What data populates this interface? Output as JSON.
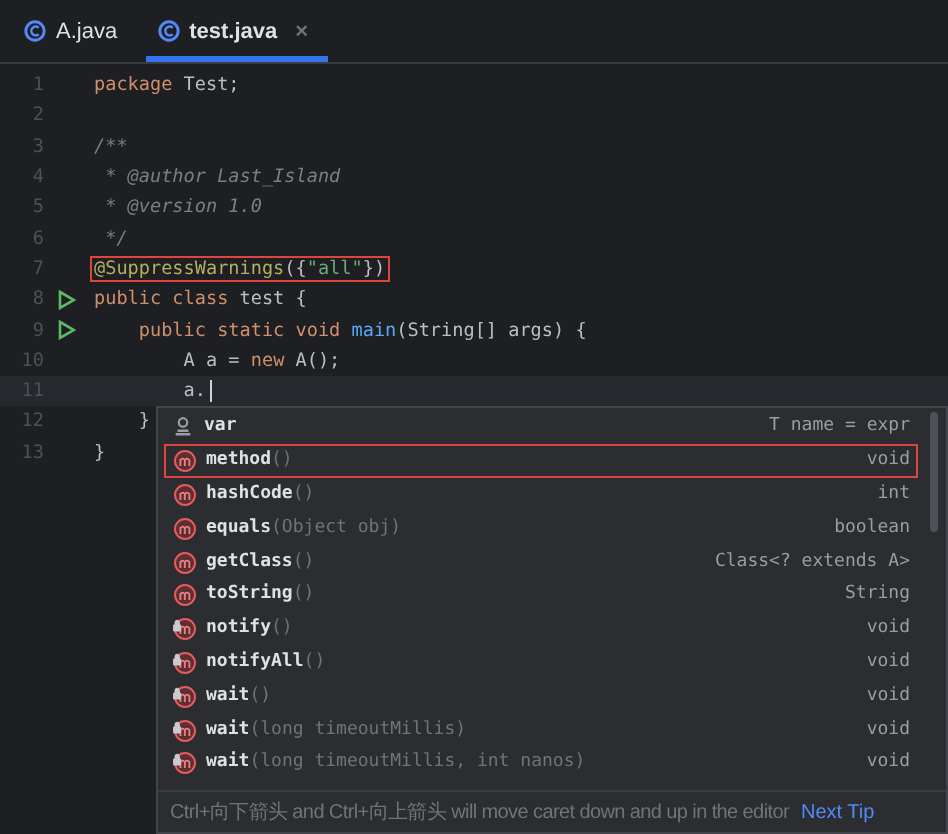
{
  "tabs": [
    {
      "label": "A.java",
      "selected": false
    },
    {
      "label": "test.java",
      "selected": true,
      "close": "×"
    }
  ],
  "code_lines": [
    {
      "number": "1",
      "run": false,
      "current": false,
      "highlighted": false,
      "tokens": [
        {
          "kind": "keyword",
          "text": "package "
        },
        {
          "kind": "plain",
          "text": "Test;"
        }
      ]
    },
    {
      "number": "2",
      "run": false,
      "current": false
    },
    {
      "number": "3",
      "run": false,
      "current": false,
      "highlighted": false,
      "tokens": [
        {
          "kind": "comment",
          "text": "/**"
        }
      ]
    },
    {
      "number": "4",
      "run": false,
      "current": false,
      "highlighted": false,
      "tokens": [
        {
          "kind": "comment",
          "text": " * @author Last_Island"
        }
      ]
    },
    {
      "number": "5",
      "run": false,
      "current": false,
      "highlighted": false,
      "tokens": [
        {
          "kind": "comment",
          "text": " * @version 1.0"
        }
      ]
    },
    {
      "number": "6",
      "run": false,
      "current": false,
      "highlighted": false,
      "tokens": [
        {
          "kind": "comment",
          "text": " */"
        }
      ]
    },
    {
      "number": "7",
      "run": false,
      "current": false,
      "highlighted": true,
      "tokens": [
        {
          "kind": "annotation",
          "text": "@SuppressWarnings"
        },
        {
          "kind": "plain",
          "text": "({"
        },
        {
          "kind": "string",
          "text": "\"all\""
        },
        {
          "kind": "plain",
          "text": "})"
        }
      ]
    },
    {
      "number": "8",
      "run": true,
      "current": false,
      "highlighted": false,
      "tokens": [
        {
          "kind": "keyword",
          "text": "public class "
        },
        {
          "kind": "plain",
          "text": "test {"
        }
      ]
    },
    {
      "number": "9",
      "run": true,
      "current": false,
      "highlighted": false,
      "tokens": [
        {
          "kind": "keyword",
          "text": "    public static void "
        },
        {
          "kind": "method",
          "text": "main"
        },
        {
          "kind": "plain",
          "text": "(String[] args) {"
        }
      ]
    },
    {
      "number": "10",
      "run": false,
      "current": false,
      "highlighted": false,
      "tokens": [
        {
          "kind": "plain",
          "text": "        A a = "
        },
        {
          "kind": "keyword",
          "text": "new "
        },
        {
          "kind": "plain",
          "text": "A();"
        }
      ]
    },
    {
      "number": "11",
      "run": false,
      "current": true,
      "highlighted": false,
      "tokens": [
        {
          "kind": "plain",
          "text": "        a."
        }
      ]
    },
    {
      "number": "12",
      "run": false,
      "current": false,
      "highlighted": false,
      "tokens": [
        {
          "kind": "plain",
          "text": "    }"
        }
      ]
    },
    {
      "number": "13",
      "run": false,
      "current": false,
      "highlighted": false,
      "tokens": [
        {
          "kind": "plain",
          "text": "}"
        }
      ]
    }
  ],
  "completion": {
    "items": [
      {
        "kind": "variable",
        "name": "var",
        "type": "T name = expr",
        "boxed": false
      },
      {
        "kind": "method",
        "name": "method",
        "params": "()",
        "type": "void",
        "boxed": true
      },
      {
        "kind": "method",
        "name": "hashCode",
        "params": "()",
        "type": "int",
        "boxed": false
      },
      {
        "kind": "method",
        "name": "equals",
        "params": "(Object obj)",
        "type": "boolean",
        "boxed": false
      },
      {
        "kind": "method",
        "name": "getClass",
        "params": "()",
        "type": "Class<? extends A>",
        "boxed": false
      },
      {
        "kind": "method",
        "name": "toString",
        "params": "()",
        "type": "String",
        "boxed": false
      },
      {
        "kind": "locked-method",
        "name": "notify",
        "params": "()",
        "type": "void",
        "boxed": false
      },
      {
        "kind": "locked-method",
        "name": "notifyAll",
        "params": "()",
        "type": "void",
        "boxed": false
      },
      {
        "kind": "locked-method",
        "name": "wait",
        "params": "()",
        "type": "void",
        "boxed": false
      },
      {
        "kind": "locked-method",
        "name": "wait",
        "params": "(long timeoutMillis)",
        "type": "void",
        "boxed": false
      },
      {
        "kind": "locked-method",
        "name": "wait",
        "params": "(long timeoutMillis, int nanos)",
        "type": "void",
        "boxed": false
      }
    ],
    "hint": "Ctrl+向下箭头 and Ctrl+向上箭头 will move caret down and up in the editor",
    "next_tip": "Next Tip"
  }
}
